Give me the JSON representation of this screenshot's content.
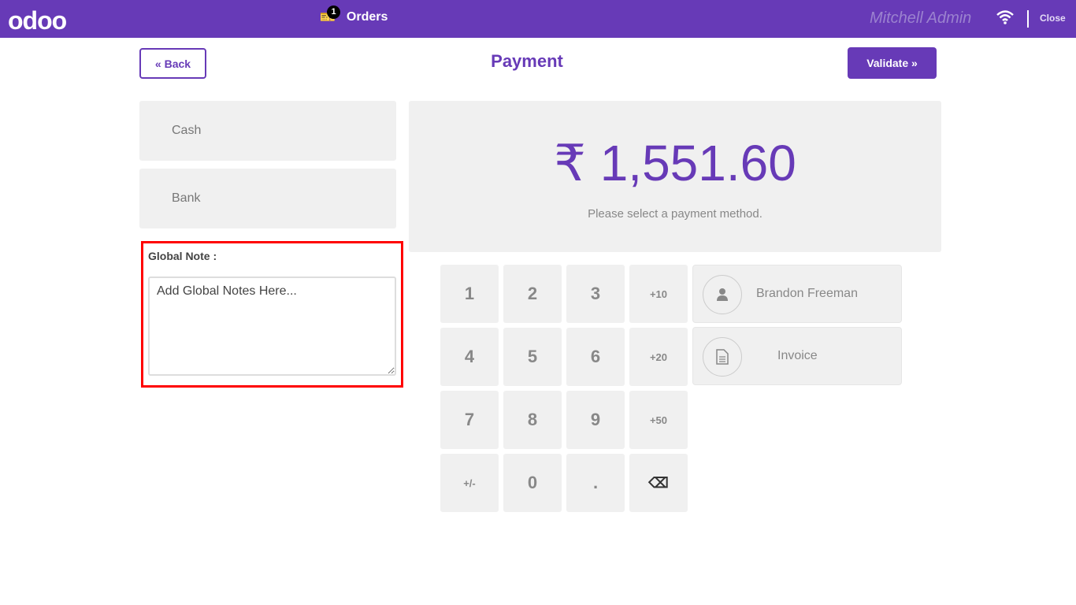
{
  "header": {
    "logo": "odoo",
    "orders_label": "Orders",
    "orders_count": "1",
    "user": "Mitchell Admin",
    "close_label": "Close",
    "icons": {
      "orders": "ticket-icon",
      "network": "wifi-icon"
    }
  },
  "toolbar": {
    "back_label": "« Back",
    "title": "Payment",
    "validate_label": "Validate »"
  },
  "payment_methods": [
    {
      "label": "Cash"
    },
    {
      "label": "Bank"
    }
  ],
  "global_note": {
    "label": "Global Note :",
    "value": "Add Global Notes Here..."
  },
  "summary": {
    "amount": "₹ 1,551.60",
    "message": "Please select a payment method."
  },
  "numpad": [
    "1",
    "2",
    "3",
    "+10",
    "4",
    "5",
    "6",
    "+20",
    "7",
    "8",
    "9",
    "+50",
    "+/-",
    "0",
    ".",
    "⌫"
  ],
  "customer": {
    "label": "Brandon Freeman",
    "icon": "user-icon"
  },
  "invoice": {
    "label": "Invoice",
    "icon": "document-icon"
  },
  "colors": {
    "brand": "#673ab7",
    "highlight": "#ff0000"
  }
}
